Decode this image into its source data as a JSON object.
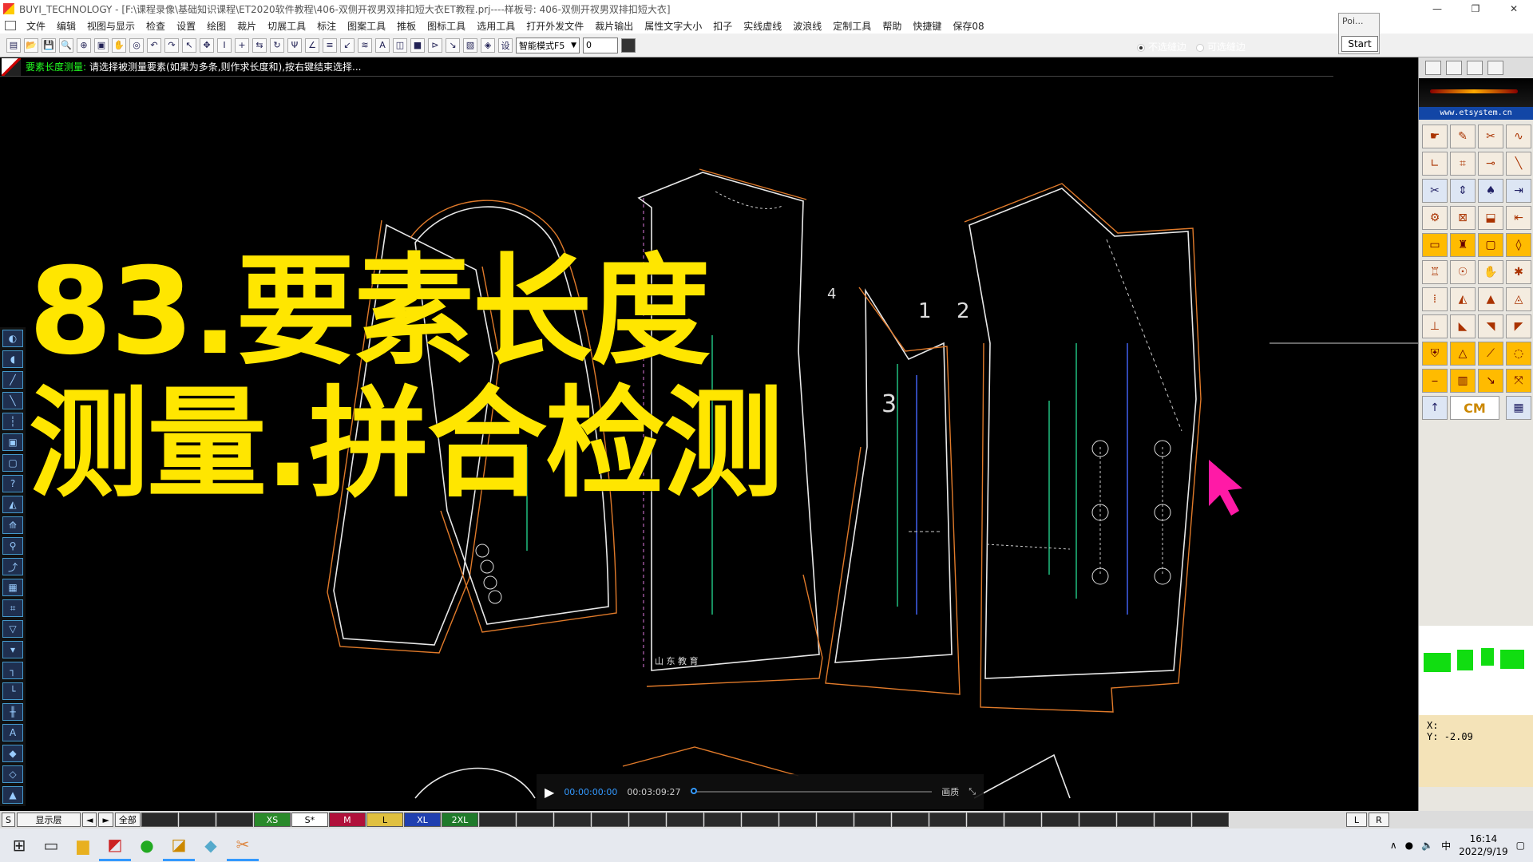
{
  "window": {
    "title": "BUYI_TECHNOLOGY - [F:\\课程录像\\基础知识课程\\ET2020软件教程\\406-双侧开衩男双排扣短大衣ET教程.prj----样板号: 406-双侧开衩男双排扣短大衣]",
    "minimize": "—",
    "restore": "❐",
    "close": "✕"
  },
  "menubar": {
    "items": [
      "文件",
      "编辑",
      "视图与显示",
      "检查",
      "设置",
      "绘图",
      "裁片",
      "切展工具",
      "标注",
      "图案工具",
      "推板",
      "图标工具",
      "选用工具",
      "打开外发文件",
      "裁片输出",
      "属性文字大小",
      "扣子",
      "实线虚线",
      "波浪线",
      "定制工具",
      "帮助",
      "快捷键",
      "保存08"
    ]
  },
  "toolbar": {
    "mode_select": "智能模式F5",
    "value_input": "0"
  },
  "seam_options": {
    "no_seam": "不选缝边",
    "with_seam": "可选缝边"
  },
  "poi_popup": {
    "title": "Poi...",
    "start_label": "Start"
  },
  "status": {
    "label": "要素长度测量:",
    "text": "请选择被测量要素(如果为多条,则作求长度和),按右键结束选择..."
  },
  "overlay": {
    "line1": "83.要素长度",
    "line2": "测量.拼合检测"
  },
  "canvas_labels": {
    "n1": "1",
    "n2": "2",
    "n3": "3",
    "n4": "4"
  },
  "right_panel": {
    "url": "www.etsystem.cn",
    "cm_label": "CM",
    "x_label": "X:",
    "x_value": "",
    "y_label": "Y:",
    "y_value": "-2.09"
  },
  "video": {
    "current_time": "00:00:00:00",
    "total_time": "00:03:09:27",
    "quality": "画质"
  },
  "sizebar": {
    "s": "S",
    "layer": "显示层",
    "prev": "◄",
    "next": "►",
    "all": "全部",
    "sizes": [
      {
        "label": "XS",
        "color": "#2a8a2a"
      },
      {
        "label": "S*",
        "color": "#ffffff"
      },
      {
        "label": "M",
        "color": "#b0103a"
      },
      {
        "label": "L",
        "color": "#e0c040"
      },
      {
        "label": "XL",
        "color": "#2040b0"
      },
      {
        "label": "2XL",
        "color": "#1f7a2a"
      }
    ],
    "l": "L",
    "r": "R"
  },
  "tray": {
    "time": "16:14",
    "date": "2022/9/19"
  }
}
